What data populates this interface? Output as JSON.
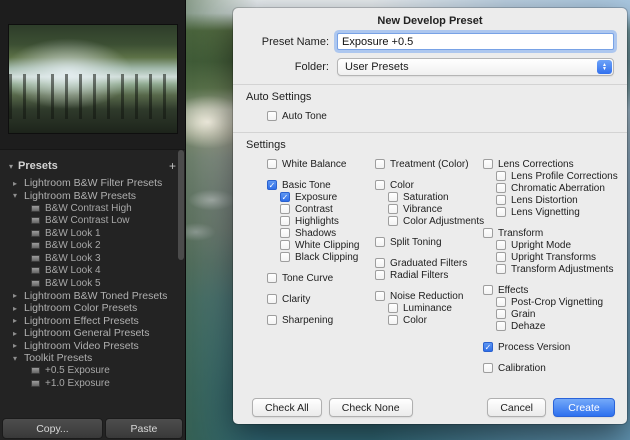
{
  "left_panel": {
    "header_label": "Presets",
    "plus": "+",
    "tree": [
      {
        "label": "Lightroom B&W Filter Presets",
        "type": "folder",
        "expanded": false
      },
      {
        "label": "Lightroom B&W Presets",
        "type": "folder",
        "expanded": true
      },
      {
        "label": "B&W Contrast High",
        "type": "preset"
      },
      {
        "label": "B&W Contrast Low",
        "type": "preset"
      },
      {
        "label": "B&W Look 1",
        "type": "preset"
      },
      {
        "label": "B&W Look 2",
        "type": "preset"
      },
      {
        "label": "B&W Look 3",
        "type": "preset"
      },
      {
        "label": "B&W Look 4",
        "type": "preset"
      },
      {
        "label": "B&W Look 5",
        "type": "preset"
      },
      {
        "label": "Lightroom B&W Toned Presets",
        "type": "folder",
        "expanded": false
      },
      {
        "label": "Lightroom Color Presets",
        "type": "folder",
        "expanded": false
      },
      {
        "label": "Lightroom Effect Presets",
        "type": "folder",
        "expanded": false
      },
      {
        "label": "Lightroom General Presets",
        "type": "folder",
        "expanded": false
      },
      {
        "label": "Lightroom Video Presets",
        "type": "folder",
        "expanded": false
      },
      {
        "label": "Toolkit Presets",
        "type": "folder",
        "expanded": true
      },
      {
        "label": "+0.5 Exposure",
        "type": "preset"
      },
      {
        "label": "+1.0 Exposure",
        "type": "preset"
      }
    ],
    "copy_label": "Copy...",
    "paste_label": "Paste"
  },
  "dialog": {
    "title": "New Develop Preset",
    "preset_name_label": "Preset Name:",
    "preset_name_value": "Exposure +0.5",
    "folder_label": "Folder:",
    "folder_value": "User Presets",
    "auto_settings_label": "Auto Settings",
    "auto_tone": {
      "label": "Auto Tone",
      "checked": false
    },
    "settings_label": "Settings",
    "settings_columns": [
      {
        "groups": [
          [
            {
              "label": "White Balance",
              "checked": false
            }
          ],
          [
            {
              "label": "Basic Tone",
              "checked": true
            },
            {
              "label": "Exposure",
              "checked": true,
              "indent": true
            },
            {
              "label": "Contrast",
              "checked": false,
              "indent": true
            },
            {
              "label": "Highlights",
              "checked": false,
              "indent": true
            },
            {
              "label": "Shadows",
              "checked": false,
              "indent": true
            },
            {
              "label": "White Clipping",
              "checked": false,
              "indent": true
            },
            {
              "label": "Black Clipping",
              "checked": false,
              "indent": true
            }
          ],
          [
            {
              "label": "Tone Curve",
              "checked": false
            }
          ],
          [
            {
              "label": "Clarity",
              "checked": false
            }
          ],
          [
            {
              "label": "Sharpening",
              "checked": false
            }
          ]
        ]
      },
      {
        "groups": [
          [
            {
              "label": "Treatment (Color)",
              "checked": false
            }
          ],
          [
            {
              "label": "Color",
              "checked": false
            },
            {
              "label": "Saturation",
              "checked": false,
              "indent": true
            },
            {
              "label": "Vibrance",
              "checked": false,
              "indent": true
            },
            {
              "label": "Color Adjustments",
              "checked": false,
              "indent": true
            }
          ],
          [
            {
              "label": "Split Toning",
              "checked": false
            }
          ],
          [
            {
              "label": "Graduated Filters",
              "checked": false
            },
            {
              "label": "Radial Filters",
              "checked": false
            }
          ],
          [
            {
              "label": "Noise Reduction",
              "checked": false
            },
            {
              "label": "Luminance",
              "checked": false,
              "indent": true
            },
            {
              "label": "Color",
              "checked": false,
              "indent": true
            }
          ]
        ]
      },
      {
        "groups": [
          [
            {
              "label": "Lens Corrections",
              "checked": false
            },
            {
              "label": "Lens Profile Corrections",
              "checked": false,
              "indent": true
            },
            {
              "label": "Chromatic Aberration",
              "checked": false,
              "indent": true
            },
            {
              "label": "Lens Distortion",
              "checked": false,
              "indent": true
            },
            {
              "label": "Lens Vignetting",
              "checked": false,
              "indent": true
            }
          ],
          [
            {
              "label": "Transform",
              "checked": false
            },
            {
              "label": "Upright Mode",
              "checked": false,
              "indent": true
            },
            {
              "label": "Upright Transforms",
              "checked": false,
              "indent": true
            },
            {
              "label": "Transform Adjustments",
              "checked": false,
              "indent": true
            }
          ],
          [
            {
              "label": "Effects",
              "checked": false
            },
            {
              "label": "Post-Crop Vignetting",
              "checked": false,
              "indent": true
            },
            {
              "label": "Grain",
              "checked": false,
              "indent": true
            },
            {
              "label": "Dehaze",
              "checked": false,
              "indent": true
            }
          ],
          [
            {
              "label": "Process Version",
              "checked": true
            }
          ],
          [
            {
              "label": "Calibration",
              "checked": false
            }
          ]
        ]
      }
    ],
    "footer": {
      "check_all": "Check All",
      "check_none": "Check None",
      "cancel": "Cancel",
      "create": "Create"
    },
    "colors": {
      "accent": "#3478f6",
      "checkbox_checked": "#3b7df5"
    }
  }
}
